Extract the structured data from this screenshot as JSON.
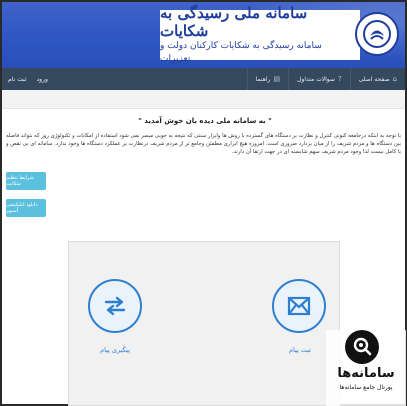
{
  "header": {
    "title": "سامانه ملی رسیدگی به شکایات",
    "subtitle": "سامانه رسیدگی به شکایات کارکنان دولت و تعزیرات"
  },
  "navbar": {
    "items": [
      {
        "label": "صفحه اصلی",
        "icon": "home-icon"
      },
      {
        "label": "سوالات متداول",
        "icon": "help-icon"
      },
      {
        "label": "راهنما",
        "icon": "book-icon"
      }
    ],
    "login_label": "ورود",
    "register_label": "ثبت نام"
  },
  "main": {
    "welcome": "\" به سامانه ملی دیده بان خوش آمدید \"",
    "description": "با توجه به اینکه درجامعه کنونی کنترل و نظارت بر دستگاه های گسترده با روش ها وابزار سنتی که نتیجه به خوبی میسر نمی شود استفاده از امکانات و تکنولوژی روز که بتواند فاصله بین دستگاه ها و مردم شریف را از میان بردارد ضروری است. امروزه هیچ ابزاری مطمئن وجامع تر از مردم شریف درنظارت بر عملکرد دستگاه ها وجود ندارد. سامانه ای بی نقص و یا کامل نیست لذا وجود مردم شریف سهم شایسته ای در جهت ارتقا آن دارند.",
    "side_buttons": [
      "شرایط تنظیم شکایت",
      "دانلود اپلیکیشن آسیور"
    ]
  },
  "actions": [
    {
      "label": "پیگیری پیام",
      "icon": "exchange-arrows-icon"
    },
    {
      "label": "ثبت پیام",
      "icon": "envelope-icon"
    }
  ],
  "watermark": {
    "brand": "سامانه‌ها",
    "tagline": "پورتال جامع سامانه‌ها",
    "icon": "magnifier-icon"
  },
  "colors": {
    "header_blue": "#2d55c4",
    "navbar": "#34495e",
    "side_button": "#5bc0de",
    "action_blue": "#2f7fd1"
  }
}
